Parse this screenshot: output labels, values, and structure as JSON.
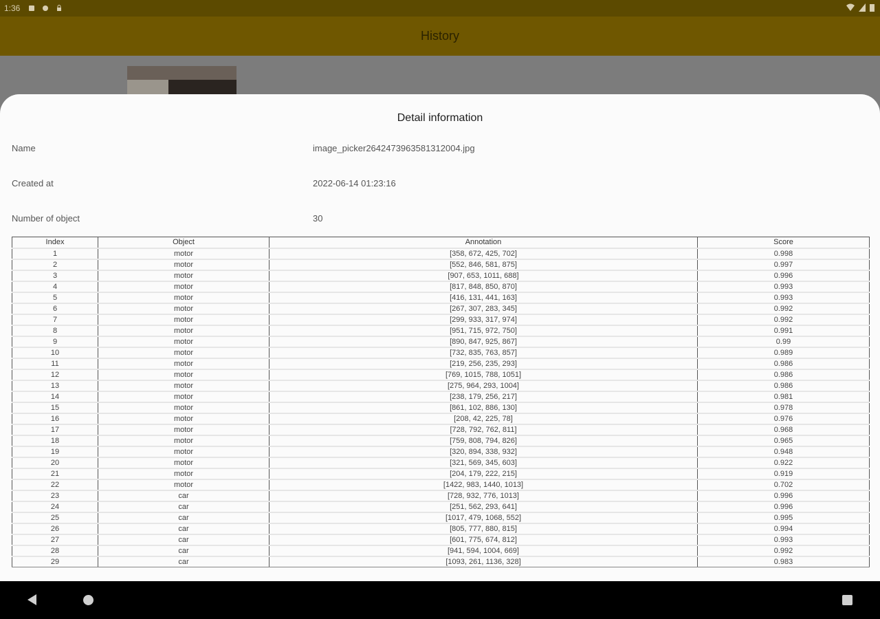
{
  "status_bar": {
    "time": "1:36",
    "icons": [
      "media-icon",
      "assistant-icon",
      "lock-icon"
    ],
    "right_icons": [
      "wifi-icon",
      "signal-icon",
      "battery-icon"
    ]
  },
  "app_bar": {
    "title": "History"
  },
  "detail": {
    "title": "Detail information",
    "name_label": "Name",
    "name_value": "image_picker2642473963581312004.jpg",
    "created_label": "Created at",
    "created_value": "2022-06-14 01:23:16",
    "count_label": "Number of object",
    "count_value": "30"
  },
  "table": {
    "headers": [
      "Index",
      "Object",
      "Annotation",
      "Score"
    ],
    "rows": [
      [
        "1",
        "motor",
        "[358, 672, 425, 702]",
        "0.998"
      ],
      [
        "2",
        "motor",
        "[552, 846, 581, 875]",
        "0.997"
      ],
      [
        "3",
        "motor",
        "[907, 653, 1011, 688]",
        "0.996"
      ],
      [
        "4",
        "motor",
        "[817, 848, 850, 870]",
        "0.993"
      ],
      [
        "5",
        "motor",
        "[416, 131, 441, 163]",
        "0.993"
      ],
      [
        "6",
        "motor",
        "[267, 307, 283, 345]",
        "0.992"
      ],
      [
        "7",
        "motor",
        "[299, 933, 317, 974]",
        "0.992"
      ],
      [
        "8",
        "motor",
        "[951, 715, 972, 750]",
        "0.991"
      ],
      [
        "9",
        "motor",
        "[890, 847, 925, 867]",
        "0.99"
      ],
      [
        "10",
        "motor",
        "[732, 835, 763, 857]",
        "0.989"
      ],
      [
        "11",
        "motor",
        "[219, 256, 235, 293]",
        "0.986"
      ],
      [
        "12",
        "motor",
        "[769, 1015, 788, 1051]",
        "0.986"
      ],
      [
        "13",
        "motor",
        "[275, 964, 293, 1004]",
        "0.986"
      ],
      [
        "14",
        "motor",
        "[238, 179, 256, 217]",
        "0.981"
      ],
      [
        "15",
        "motor",
        "[861, 102, 886, 130]",
        "0.978"
      ],
      [
        "16",
        "motor",
        "[208, 42, 225, 78]",
        "0.976"
      ],
      [
        "17",
        "motor",
        "[728, 792, 762, 811]",
        "0.968"
      ],
      [
        "18",
        "motor",
        "[759, 808, 794, 826]",
        "0.965"
      ],
      [
        "19",
        "motor",
        "[320, 894, 338, 932]",
        "0.948"
      ],
      [
        "20",
        "motor",
        "[321, 569, 345, 603]",
        "0.922"
      ],
      [
        "21",
        "motor",
        "[204, 179, 222, 215]",
        "0.919"
      ],
      [
        "22",
        "motor",
        "[1422, 983, 1440, 1013]",
        "0.702"
      ],
      [
        "23",
        "car",
        "[728, 932, 776, 1013]",
        "0.996"
      ],
      [
        "24",
        "car",
        "[251, 562, 293, 641]",
        "0.996"
      ],
      [
        "25",
        "car",
        "[1017, 479, 1068, 552]",
        "0.995"
      ],
      [
        "26",
        "car",
        "[805, 777, 880, 815]",
        "0.994"
      ],
      [
        "27",
        "car",
        "[601, 775, 674, 812]",
        "0.993"
      ],
      [
        "28",
        "car",
        "[941, 594, 1004, 669]",
        "0.992"
      ],
      [
        "29",
        "car",
        "[1093, 261, 1136, 328]",
        "0.983"
      ]
    ]
  },
  "nav": {
    "back_icon": "back-icon",
    "home_icon": "home-icon",
    "recents_icon": "recents-icon"
  }
}
